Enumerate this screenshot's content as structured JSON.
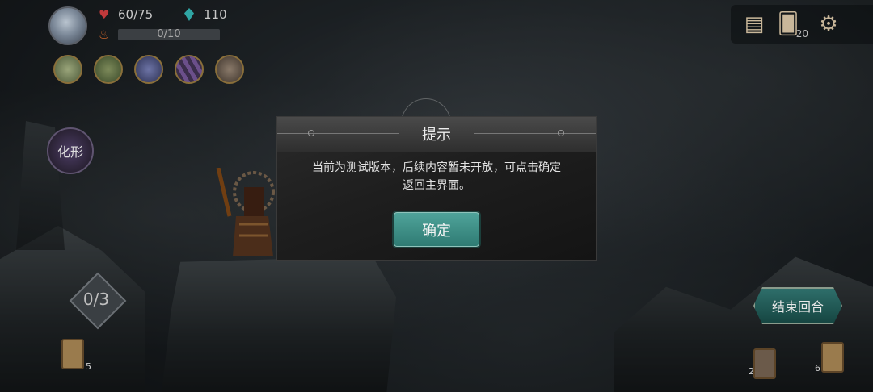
{
  "hud": {
    "hp": "60/75",
    "gems": "110",
    "energy": "0/10",
    "relics": [
      {
        "icon": "egg-relic-icon"
      },
      {
        "icon": "urn-relic-icon"
      },
      {
        "icon": "orb-relic-icon"
      },
      {
        "icon": "claw-relic-icon"
      },
      {
        "icon": "bell-relic-icon"
      }
    ],
    "deck_count": "20",
    "transform_label": "化形",
    "counter": "0/3",
    "draw_pile_count": "5",
    "discard_count": "2",
    "exhaust_count": "6",
    "end_turn_label": "结束回合"
  },
  "dialog": {
    "title": "提示",
    "message_line1": "当前为测试版本，后续内容暂未开放，可点击确定",
    "message_line2": "返回主界面。",
    "confirm_label": "确定"
  },
  "colors": {
    "accent_teal": "#3d8f86",
    "heart": "#c0393b",
    "gem": "#2fa5a4"
  }
}
